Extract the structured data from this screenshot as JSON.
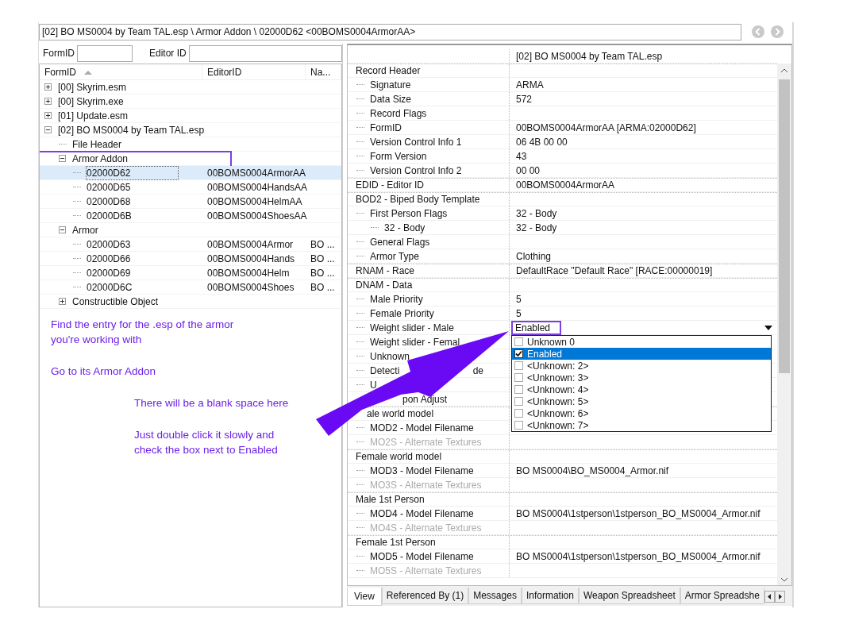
{
  "path_bar": {
    "value": "[02] BO MS0004 by Team TAL.esp \\ Armor Addon \\ 02000D62 <00BOMS0004ArmorAA>"
  },
  "filters": [
    {
      "label": "FormID"
    },
    {
      "label": "Editor ID"
    }
  ],
  "tree": {
    "columns": [
      {
        "label": "FormID",
        "sorted": true
      },
      {
        "label": "EditorID",
        "sorted": false
      },
      {
        "label": "Na...",
        "sorted": false
      }
    ],
    "nodes": [
      {
        "cells": [
          "[00] Skyrim.esm"
        ],
        "expanded": false,
        "selected": false
      },
      {
        "cells": [
          "[00] Skyrim.exe"
        ],
        "expanded": false,
        "selected": false
      },
      {
        "cells": [
          "[01] Update.esm"
        ],
        "expanded": false,
        "selected": false
      },
      {
        "cells": [
          "[02] BO MS0004 by Team TAL.esp"
        ],
        "expanded": true,
        "selected": false,
        "children": [
          {
            "cells": [
              "File Header"
            ],
            "selected": false
          },
          {
            "cells": [
              "Armor Addon"
            ],
            "expanded": true,
            "selected": false,
            "highlighted": true,
            "children": [
              {
                "cells": [
                  "02000D62",
                  "00BOMS0004ArmorAA"
                ],
                "selected": true
              },
              {
                "cells": [
                  "02000D65",
                  "00BOMS0004HandsAA"
                ],
                "selected": false
              },
              {
                "cells": [
                  "02000D68",
                  "00BOMS0004HelmAA"
                ],
                "selected": false
              },
              {
                "cells": [
                  "02000D6B",
                  "00BOMS0004ShoesAA"
                ],
                "selected": false
              }
            ]
          },
          {
            "cells": [
              "Armor"
            ],
            "expanded": true,
            "selected": false,
            "children": [
              {
                "cells": [
                  "02000D63",
                  "00BOMS0004Armor",
                  "BO ..."
                ],
                "selected": false
              },
              {
                "cells": [
                  "02000D66",
                  "00BOMS0004Hands",
                  "BO ..."
                ],
                "selected": false
              },
              {
                "cells": [
                  "02000D69",
                  "00BOMS0004Helm",
                  "BO ..."
                ],
                "selected": false
              },
              {
                "cells": [
                  "02000D6C",
                  "00BOMS0004Shoes",
                  "BO ..."
                ],
                "selected": false
              }
            ]
          },
          {
            "cells": [
              "Constructible Object"
            ],
            "expanded": false,
            "selected": false
          }
        ]
      }
    ]
  },
  "annotations": [
    {
      "kind": "step",
      "text": "Find the entry for the .esp of the armor\nyou're working with"
    },
    {
      "kind": "step",
      "text": "Go to its Armor Addon"
    },
    {
      "kind": "tip",
      "text": "There will be a blank space here"
    },
    {
      "kind": "tip",
      "text": "Just double click it slowly and\ncheck the box next to Enabled"
    }
  ],
  "record": {
    "header": "[02] BO MS0004 by Team TAL.esp",
    "rows": [
      {
        "label": "Record Header",
        "children": [
          {
            "label": "Signature",
            "value": "ARMA"
          },
          {
            "label": "Data Size",
            "value": "572"
          },
          {
            "label": "Record Flags"
          },
          {
            "label": "FormID",
            "value": "00BOMS0004ArmorAA [ARMA:02000D62]"
          },
          {
            "label": "Version Control Info 1",
            "value": "06 4B 00 00"
          },
          {
            "label": "Form Version",
            "value": "43"
          },
          {
            "label": "Version Control Info 2",
            "value": "00 00"
          }
        ]
      },
      {
        "label": "EDID - Editor ID",
        "value": "00BOMS0004ArmorAA"
      },
      {
        "label": "BOD2 - Biped Body Template",
        "children": [
          {
            "label": "First Person Flags",
            "value": "32 - Body",
            "children": [
              {
                "label": "32 - Body",
                "value": "32 - Body"
              }
            ]
          },
          {
            "label": "General Flags"
          },
          {
            "label": "Armor Type",
            "value": "Clothing"
          }
        ]
      },
      {
        "label": "RNAM - Race",
        "value": "DefaultRace \"Default Race\" [RACE:00000019]"
      },
      {
        "label": "DNAM - Data",
        "children": [
          {
            "label": "Male Priority",
            "value": "5"
          },
          {
            "label": "Female Priority",
            "value": "5"
          },
          {
            "label": "Weight slider - Male",
            "value": "Enabled",
            "highlighted": true,
            "dropdown": [
              {
                "label": "Unknown 0",
                "checked": false,
                "selected": false
              },
              {
                "label": "Enabled",
                "checked": true,
                "selected": true
              },
              {
                "label": "<Unknown: 2>",
                "checked": false,
                "selected": false
              },
              {
                "label": "<Unknown: 3>",
                "checked": false,
                "selected": false
              },
              {
                "label": "<Unknown: 4>",
                "checked": false,
                "selected": false
              },
              {
                "label": "<Unknown: 5>",
                "checked": false,
                "selected": false
              },
              {
                "label": "<Unknown: 6>",
                "checked": false,
                "selected": false
              },
              {
                "label": "<Unknown: 7>",
                "checked": false,
                "selected": false
              }
            ]
          },
          {
            "label": "Weight slider - Femal"
          },
          {
            "label": "Unknown"
          },
          {
            "label": "Detecti",
            "label_tail": "de"
          },
          {
            "label": "U"
          },
          {
            "label": "pon Adjust",
            "covered": true
          }
        ]
      },
      {
        "label": "ale world model",
        "covered": true,
        "children": [
          {
            "label": "MOD2 - Model Filename"
          },
          {
            "label": "MO2S - Alternate Textures",
            "disabled": true
          }
        ]
      },
      {
        "label": "Female world model",
        "children": [
          {
            "label": "MOD3 - Model Filename",
            "value": "BO MS0004\\BO_MS0004_Armor.nif"
          },
          {
            "label": "MO3S - Alternate Textures",
            "disabled": true
          }
        ]
      },
      {
        "label": "Male 1st Person",
        "children": [
          {
            "label": "MOD4 - Model Filename",
            "value": "BO MS0004\\1stperson\\1stperson_BO_MS0004_Armor.nif"
          },
          {
            "label": "MO4S - Alternate Textures",
            "disabled": true
          }
        ]
      },
      {
        "label": "Female 1st Person",
        "children": [
          {
            "label": "MOD5 - Model Filename",
            "value": "BO MS0004\\1stperson\\1stperson_BO_MS0004_Armor.nif"
          },
          {
            "label": "MO5S - Alternate Textures",
            "disabled": true
          }
        ]
      }
    ]
  },
  "tabs": [
    {
      "label": "View",
      "selected": true
    },
    {
      "label": "Referenced By (1)",
      "selected": false
    },
    {
      "label": "Messages",
      "selected": false
    },
    {
      "label": "Information",
      "selected": false
    },
    {
      "label": "Weapon Spreadsheet",
      "selected": false
    },
    {
      "label": "Armor Spreadshe",
      "selected": false
    }
  ]
}
